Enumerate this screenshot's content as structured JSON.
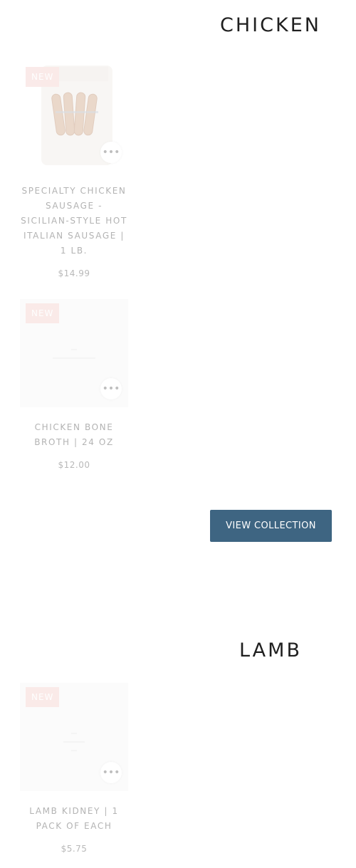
{
  "sections": [
    {
      "title": "CHICKEN",
      "products": [
        {
          "badge": "NEW",
          "title": "SPECIALTY CHICKEN SAUSAGE - SICILIAN-STYLE HOT ITALIAN SAUSAGE | 1 LB.",
          "price": "$14.99",
          "more_icon": "ellipsis-icon"
        },
        {
          "badge": "NEW",
          "title": "CHICKEN BONE BROTH | 24 OZ",
          "price": "$12.00",
          "more_icon": "ellipsis-icon"
        }
      ],
      "view_collection_label": "VIEW COLLECTION"
    },
    {
      "title": "LAMB",
      "products": [
        {
          "badge": "NEW",
          "title": "LAMB KIDNEY | 1 PACK OF EACH",
          "price": "$5.75",
          "more_icon": "ellipsis-icon"
        }
      ]
    }
  ],
  "colors": {
    "button_bg": "#3e6582",
    "badge_bg": "#f7d9d6",
    "heading": "#1f1f1f",
    "muted_text": "#b3b3b3"
  }
}
